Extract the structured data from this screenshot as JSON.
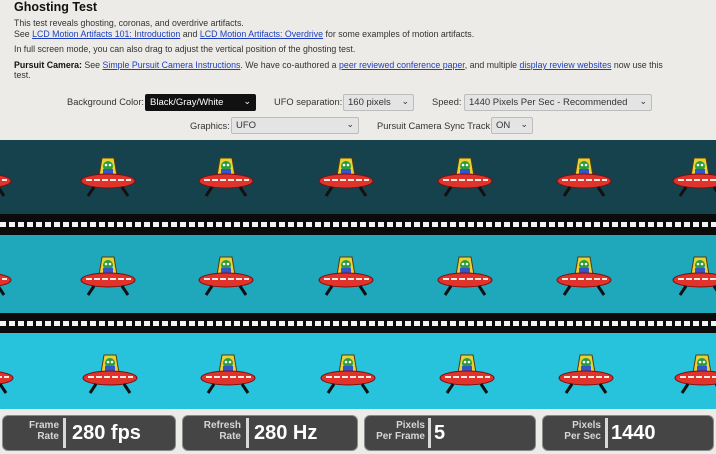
{
  "header": {
    "title": "Ghosting Test",
    "line1": "This test reveals ghosting, coronas, and overdrive artifacts.",
    "line2_prefix": "See",
    "link_intro": "LCD Motion Artifacts 101: Introduction",
    "line2_and": "and",
    "link_overdrive": "LCD Motion Artifacts: Overdrive",
    "line2_suffix": "for some examples of motion artifacts.",
    "line3": "In full screen mode, you can also drag to adjust the vertical position of the ghosting test.",
    "pursuit_label": "Pursuit Camera:",
    "pursuit_see": "See",
    "link_pursuit": "Simple Pursuit Camera Instructions",
    "pursuit_mid": ". We have co-authored a",
    "link_paper": "peer reviewed conference paper",
    "pursuit_and": ", and multiple",
    "link_reviews": "display review websites",
    "pursuit_end": "now use this",
    "pursuit_end2": "test."
  },
  "controls": {
    "background_label": "Background Color:",
    "background_value": "Black/Gray/White",
    "separation_label": "UFO separation:",
    "separation_value": "160 pixels",
    "speed_label": "Speed:",
    "speed_value": "1440 Pixels Per Sec - Recommended",
    "graphics_label": "Graphics:",
    "graphics_value": "UFO",
    "sync_label": "Pursuit Camera Sync Track:",
    "sync_value": "ON"
  },
  "stats": {
    "frame_rate_label_1": "Frame",
    "frame_rate_label_2": "Rate",
    "frame_rate_value": "280 fps",
    "refresh_label_1": "Refresh",
    "refresh_label_2": "Rate",
    "refresh_value": "280 Hz",
    "ppf_label_1": "Pixels",
    "ppf_label_2": "Per Frame",
    "ppf_value": "5",
    "pps_label_1": "Pixels",
    "pps_label_2": "Per Sec",
    "pps_value": "1440"
  },
  "colors": {
    "sky_dark": "#15424c",
    "sky_mid": "#1fa8bb",
    "sky_light": "#27c2dc",
    "ufo_body": "#e0332b",
    "ufo_dome": "#e8d23a"
  },
  "icons": {
    "ufo": "ufo-sprite-icon",
    "select_caret": "chevron-down-icon"
  }
}
